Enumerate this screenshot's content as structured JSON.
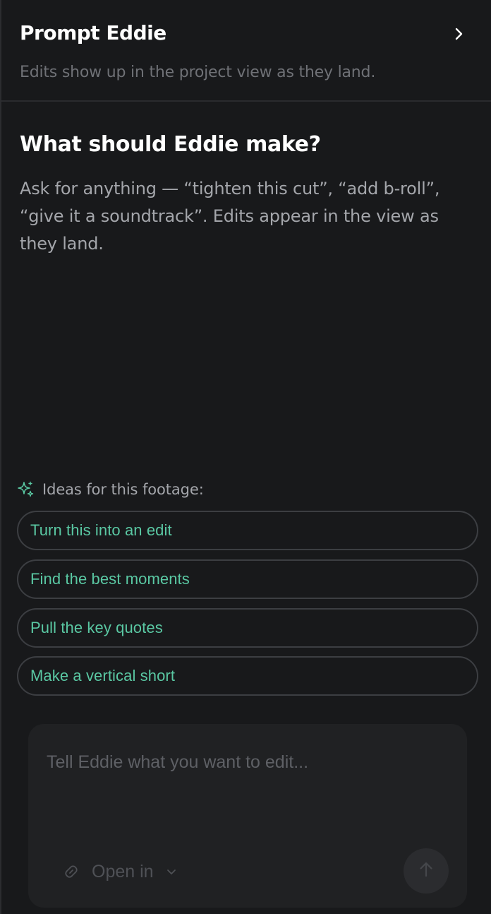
{
  "header": {
    "title": "Prompt Eddie",
    "subtitle": "Edits show up in the project view as they land.",
    "collapse_icon": "chevron-right-icon"
  },
  "hero": {
    "title": "What should Eddie make?",
    "body": "Ask for anything — “tighten this cut”, “add b-roll”, “give it a soundtrack”. Edits appear in the view as they land."
  },
  "ideas": {
    "icon": "sparkle-icon",
    "label": "Ideas for this footage:",
    "items": [
      {
        "label": "Turn this into an edit"
      },
      {
        "label": "Find the best moments"
      },
      {
        "label": "Pull the key quotes"
      },
      {
        "label": "Make a vertical short"
      }
    ]
  },
  "composer": {
    "placeholder": "Tell Eddie what you want to edit...",
    "value": "",
    "open_in_label": "Open in",
    "open_in_icon": "link-icon",
    "dropdown_icon": "chevron-down-icon",
    "send_icon": "arrow-up-icon"
  },
  "colors": {
    "background": "#18191b",
    "accent": "#5ac8a3",
    "composer_bg": "#202123",
    "muted_text": "#a4a6ab"
  }
}
